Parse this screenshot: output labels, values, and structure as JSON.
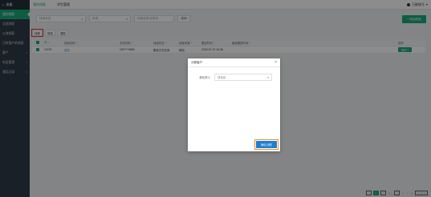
{
  "sidebar": {
    "brand": "流量",
    "items": [
      {
        "label": "我的线索",
        "active": true
      },
      {
        "label": "全部线索"
      },
      {
        "label": "公海线索"
      },
      {
        "label": "已转客户的线索"
      },
      {
        "label": "客户",
        "parent": true
      },
      {
        "label": "机会管理",
        "parent": true
      },
      {
        "label": "通话记录",
        "parent": true
      }
    ]
  },
  "topbar": {
    "tabs": [
      {
        "label": "我的线索",
        "active": true
      },
      {
        "label": "学生管理"
      }
    ],
    "user": "万能账号"
  },
  "filters": {
    "select1": "线索状态",
    "select2": "来源",
    "select3": "线索名称/手机号",
    "search": "查询"
  },
  "add_button": "+ 添加线索",
  "actions": [
    "转移",
    "释放",
    "删除"
  ],
  "table": {
    "headers": [
      "ID",
      "线索名称",
      "手机号码",
      "线索状态",
      "线索来源",
      "跟进时间",
      "最新跟进时间",
      "操作"
    ],
    "rows": [
      {
        "id": "10702",
        "name": "张四",
        "phone": "152****4656",
        "status": "联系方式无效",
        "source": "网站",
        "time": "2018-07-07 16:36",
        "latest": "",
        "op": "操作"
      }
    ]
  },
  "modal": {
    "title": "分配客户",
    "label": "新负责人",
    "placeholder": "请选择",
    "confirm": "确认分配"
  },
  "pager": {
    "prev": "‹",
    "pages": [
      "1"
    ],
    "next": "›",
    "goto": "前往",
    "page_suffix": "页",
    "total": "共 1 条",
    "page_size": "20 条/页"
  },
  "colors": {
    "accent": "#1aa97b",
    "primary": "#1d7fd1",
    "highlight": "#e23c3c"
  }
}
